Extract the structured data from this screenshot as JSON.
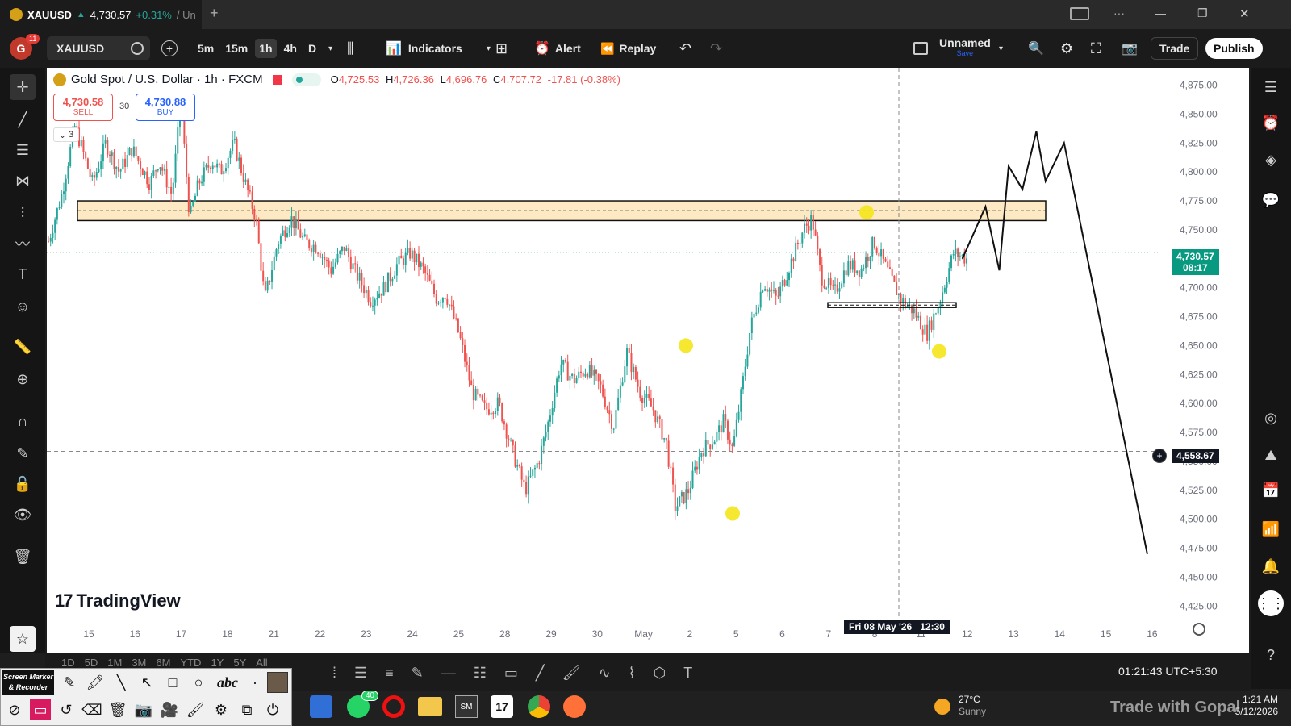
{
  "titlebar": {
    "tab_symbol": "XAUUSD",
    "tab_arrow": "▲",
    "tab_price": "4,730.57",
    "tab_change": "+0.31%",
    "tab_rest": "/ Un",
    "new_tab": "+",
    "minimize": "—",
    "restore": "❐",
    "close": "✕"
  },
  "toolbar": {
    "avatar_letter": "G",
    "notif_count": "11",
    "symbol": "XAUUSD",
    "intervals": [
      "5m",
      "15m",
      "1h",
      "4h",
      "D"
    ],
    "active_interval": "1h",
    "indicators_label": "Indicators",
    "alert_label": "Alert",
    "replay_label": "Replay",
    "layout_name": "Unnamed",
    "layout_save": "Save",
    "trade_label": "Trade",
    "publish_label": "Publish"
  },
  "legend": {
    "title": "Gold Spot / U.S. Dollar · 1h · FXCM",
    "o_label": "O",
    "o": "4,725.53",
    "h_label": "H",
    "h": "4,726.36",
    "l_label": "L",
    "l": "4,696.76",
    "c_label": "C",
    "c": "4,707.72",
    "change": "-17.81 (-0.38%)",
    "sell_price": "4,730.58",
    "sell_label": "SELL",
    "spread": "30",
    "buy_price": "4,730.88",
    "buy_label": "BUY",
    "collapse_count": "3"
  },
  "price_tags": {
    "last_price": "4,730.57",
    "countdown": "08:17",
    "crosshair_price": "4,558.67",
    "crosshair_date": "Fri 08 May '26   12:30"
  },
  "watermark": "TradingView",
  "bottombar": {
    "timeframes": [
      "1D",
      "5D",
      "1M",
      "3M",
      "6M",
      "YTD",
      "1Y",
      "5Y",
      "All"
    ],
    "clock": "01:21:43 UTC+5:30"
  },
  "taskbar": {
    "weather_temp": "27°C",
    "weather_desc": "Sunny",
    "time": "1:21 AM",
    "date": "5/12/2026",
    "whatsapp_badge": "40",
    "overlay_text": "Trade with Gopal"
  },
  "screenmarker": {
    "title_line1": "Screen Marker",
    "title_line2": "& Recorder",
    "text_tool": "abc"
  },
  "colors": {
    "up": "#26a69a",
    "down": "#ef5350",
    "zone_fill": "#fde9c3",
    "marker": "#f5e61a",
    "last_price_bg": "#089981"
  },
  "chart_data": {
    "type": "candlestick",
    "symbol": "XAUUSD",
    "timeframe": "1h",
    "ylim": [
      4412,
      4890
    ],
    "y_ticks": [
      4425,
      4450,
      4475,
      4500,
      4525,
      4550,
      4575,
      4600,
      4625,
      4650,
      4675,
      4700,
      4725,
      4750,
      4775,
      4800,
      4825,
      4850,
      4875
    ],
    "y_tick_labels": [
      "4,425.00",
      "4,450.00",
      "4,475.00",
      "4,500.00",
      "4,525.00",
      "4,550.00",
      "4,575.00",
      "4,600.00",
      "4,625.00",
      "4,650.00",
      "4,675.00",
      "4,700.00",
      "4,725.00",
      "4,750.00",
      "4,775.00",
      "4,800.00",
      "4,825.00",
      "4,850.00",
      "4,875.00"
    ],
    "x_ticks": [
      "15",
      "16",
      "17",
      "18",
      "21",
      "22",
      "23",
      "24",
      "25",
      "28",
      "29",
      "30",
      "May",
      "2",
      "5",
      "6",
      "7",
      "8",
      "11",
      "12",
      "13",
      "14",
      "15",
      "16"
    ],
    "price_path": [
      [
        0,
        4740
      ],
      [
        3,
        4780
      ],
      [
        6,
        4840
      ],
      [
        10,
        4790
      ],
      [
        13,
        4825
      ],
      [
        16,
        4800
      ],
      [
        19,
        4820
      ],
      [
        23,
        4790
      ],
      [
        25,
        4810
      ],
      [
        28,
        4780
      ],
      [
        30,
        4860
      ],
      [
        32,
        4760
      ],
      [
        34,
        4790
      ],
      [
        37,
        4810
      ],
      [
        39,
        4800
      ],
      [
        42,
        4825
      ],
      [
        45,
        4785
      ],
      [
        47,
        4760
      ],
      [
        49,
        4690
      ],
      [
        52,
        4740
      ],
      [
        55,
        4760
      ],
      [
        58,
        4740
      ],
      [
        61,
        4735
      ],
      [
        64,
        4715
      ],
      [
        67,
        4735
      ],
      [
        70,
        4710
      ],
      [
        73,
        4690
      ],
      [
        76,
        4700
      ],
      [
        79,
        4720
      ],
      [
        82,
        4730
      ],
      [
        85,
        4715
      ],
      [
        88,
        4690
      ],
      [
        90,
        4695
      ],
      [
        93,
        4660
      ],
      [
        96,
        4610
      ],
      [
        99,
        4595
      ],
      [
        102,
        4600
      ],
      [
        105,
        4560
      ],
      [
        108,
        4525
      ],
      [
        111,
        4550
      ],
      [
        113,
        4580
      ],
      [
        116,
        4635
      ],
      [
        119,
        4620
      ],
      [
        122,
        4630
      ],
      [
        125,
        4615
      ],
      [
        128,
        4580
      ],
      [
        131,
        4645
      ],
      [
        134,
        4610
      ],
      [
        137,
        4595
      ],
      [
        140,
        4565
      ],
      [
        142,
        4510
      ],
      [
        145,
        4525
      ],
      [
        148,
        4560
      ],
      [
        151,
        4570
      ],
      [
        153,
        4585
      ],
      [
        155,
        4560
      ],
      [
        157,
        4610
      ],
      [
        159,
        4665
      ],
      [
        162,
        4705
      ],
      [
        165,
        4690
      ],
      [
        168,
        4720
      ],
      [
        171,
        4750
      ],
      [
        173,
        4760
      ],
      [
        175,
        4710
      ],
      [
        178,
        4695
      ],
      [
        181,
        4720
      ],
      [
        184,
        4715
      ],
      [
        187,
        4740
      ],
      [
        190,
        4715
      ],
      [
        193,
        4690
      ],
      [
        196,
        4680
      ],
      [
        199,
        4660
      ],
      [
        202,
        4690
      ],
      [
        205,
        4730
      ],
      [
        208,
        4725
      ]
    ],
    "resistance_zone": {
      "low": 4758,
      "high": 4775
    },
    "support_level": 4685,
    "projection_path": [
      [
        4725,
        "12"
      ],
      [
        4770,
        "12.5"
      ],
      [
        4715,
        "12.8"
      ],
      [
        4805,
        "13"
      ],
      [
        4785,
        "13.3"
      ],
      [
        4835,
        "13.6"
      ],
      [
        4792,
        "13.8"
      ],
      [
        4825,
        "14.2"
      ],
      [
        4470,
        "16"
      ]
    ],
    "marked_points": [
      4650,
      4505,
      4765,
      4645
    ],
    "last_price": 4730.57,
    "crosshair_price": 4558.67
  }
}
